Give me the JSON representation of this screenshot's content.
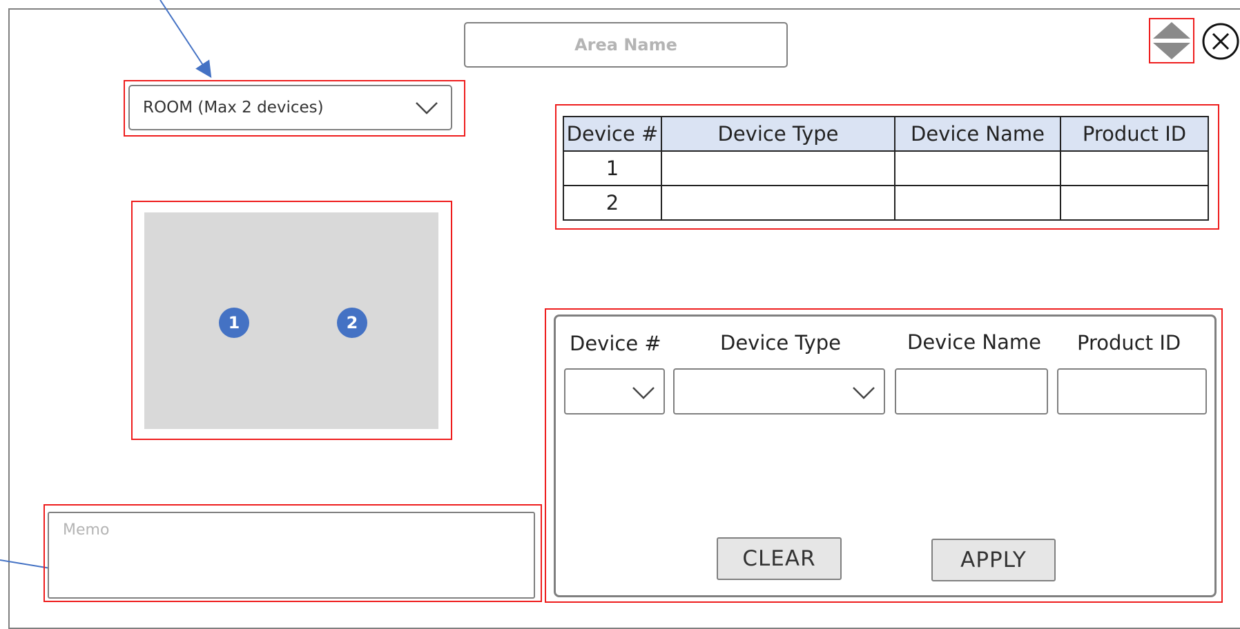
{
  "header": {
    "area_name_placeholder": "Area Name"
  },
  "room_select": {
    "selected": "ROOM (Max 2 devices)",
    "icon": "chevron-down-icon"
  },
  "floor_plan": {
    "markers": [
      "1",
      "2"
    ],
    "marker_color": "#4472c4",
    "background": "#d9d9d9"
  },
  "device_table": {
    "columns": [
      "Device #",
      "Device Type",
      "Device Name",
      "Product ID"
    ],
    "rows": [
      [
        "1",
        "",
        "",
        ""
      ],
      [
        "2",
        "",
        "",
        ""
      ]
    ],
    "header_bg": "#dae3f3"
  },
  "editor": {
    "labels": {
      "device_num": "Device #",
      "device_type": "Device Type",
      "device_name": "Device Name",
      "product_id": "Product ID"
    },
    "clear_label": "CLEAR",
    "apply_label": "APPLY"
  },
  "memo": {
    "placeholder": "Memo"
  },
  "window_controls": {
    "reorder_icon": "up-down-arrows-icon",
    "close_icon": "close-circle-icon"
  },
  "colors": {
    "annotation_red": "#ee1c1c",
    "arrow_blue": "#4472c4"
  }
}
